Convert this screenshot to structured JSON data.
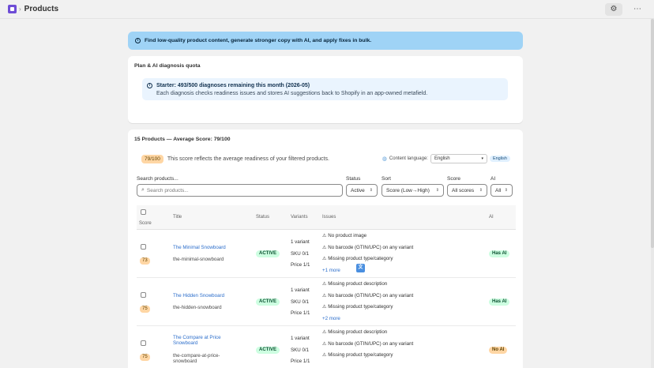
{
  "header": {
    "title": "Products",
    "settings_icon": "gear-icon",
    "more_icon": "ellipsis-icon"
  },
  "banner": {
    "text": "Find low-quality product content, generate stronger copy with AI, and apply fixes in bulk."
  },
  "quota": {
    "title": "Plan & AI diagnosis quota",
    "headline": "Starter: 493/500 diagnoses remaining this month (2026-05)",
    "description": "Each diagnosis checks readiness issues and stores AI suggestions back to Shopify in an app-owned metafield."
  },
  "products": {
    "title": "15 Products — Average Score: 79/100",
    "score_pill": "79/100",
    "score_desc": "This score reflects the average readiness of your filtered products.",
    "content_language_label": "Content language:",
    "language_value": "English",
    "language_badge": "English",
    "filters": {
      "search_label": "Search products...",
      "search_placeholder": "Search products...",
      "status_label": "Status",
      "status_value": "Active",
      "sort_label": "Sort",
      "sort_value": "Score (Low→High)",
      "score_label": "Score",
      "score_value": "All scores",
      "ai_label": "AI",
      "ai_value": "All"
    },
    "columns": {
      "score": "Score",
      "title": "Title",
      "status": "Status",
      "variants": "Variants",
      "issues": "Issues",
      "ai": "AI"
    },
    "rows": [
      {
        "score": "73",
        "title": "The Minimal Snowboard",
        "handle": "the-minimal-snowboard",
        "status": "ACTIVE",
        "variants": "1 variant",
        "sku": "SKU 0/1",
        "price": "Price 1/1",
        "issues": [
          "⚠ No product image",
          "⚠ No barcode (GTIN/UPC) on any variant",
          "⚠ Missing product type/category"
        ],
        "more": "+1 more",
        "ai": "Has AI"
      },
      {
        "score": "75",
        "title": "The Hidden Snowboard",
        "handle": "the-hidden-snowboard",
        "status": "ACTIVE",
        "variants": "1 variant",
        "sku": "SKU 0/1",
        "price": "Price 1/1",
        "issues": [
          "⚠ Missing product description",
          "⚠ No barcode (GTIN/UPC) on any variant",
          "⚠ Missing product type/category"
        ],
        "more": "+2 more",
        "ai": "Has AI"
      },
      {
        "score": "75",
        "title": "The Compare at Price Snowboard",
        "handle": "the-compare-at-price-snowboard",
        "status": "ACTIVE",
        "variants": "1 variant",
        "sku": "SKU 0/1",
        "price": "Price 1/1",
        "issues": [
          "⚠ Missing product description",
          "⚠ No barcode (GTIN/UPC) on any variant",
          "⚠ Missing product type/category"
        ],
        "more": "",
        "ai": "No AI"
      }
    ]
  }
}
